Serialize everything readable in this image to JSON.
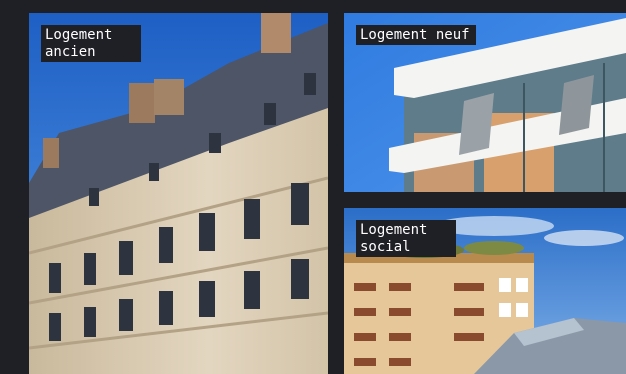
{
  "cards": {
    "ancien": {
      "label": "Logement ancien"
    },
    "neuf": {
      "label": "Logement neuf"
    },
    "social": {
      "label": "Logement social"
    }
  },
  "colors": {
    "background": "#1f1f26",
    "label_bg": "#1f1f26",
    "label_text": "#ffffff",
    "sky": "#3a7fd6",
    "stone": "#d9cbb3"
  }
}
